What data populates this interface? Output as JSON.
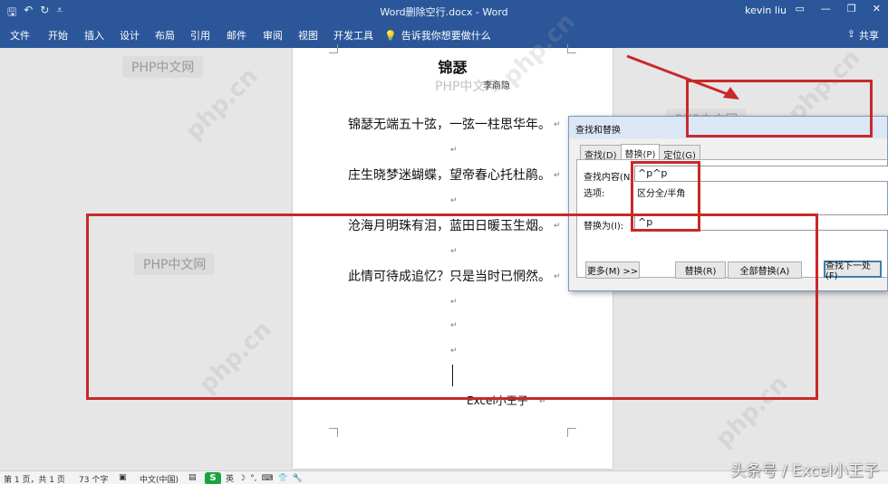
{
  "titlebar": {
    "qat_icons": [
      "save-icon",
      "undo-icon",
      "redo-icon",
      "customize-icon"
    ],
    "doc_title": "Word删除空行.docx - Word",
    "user": "kevin liu"
  },
  "ribbon": {
    "tabs": [
      "文件",
      "开始",
      "插入",
      "设计",
      "布局",
      "引用",
      "邮件",
      "审阅",
      "视图",
      "开发工具"
    ],
    "tell_me": "告诉我你想要做什么",
    "share": "共享"
  },
  "document": {
    "title": "锦瑟",
    "author": "李商隐",
    "lines": [
      "锦瑟无端五十弦，一弦一柱思华年。",
      "庄生晓梦迷蝴蝶，望帝春心托杜鹃。",
      "沧海月明珠有泪，蓝田日暖玉生烟。",
      "此情可待成追忆？只是当时已惘然。"
    ],
    "signature": "Excel小王子"
  },
  "dialog": {
    "title": "查找和替换",
    "tabs": [
      "查找(D)",
      "替换(P)",
      "定位(G)"
    ],
    "find_label": "查找内容(N):",
    "find_value": "^p^p",
    "options_label": "选项:",
    "options_value": "区分全/半角",
    "replace_label": "替换为(I):",
    "replace_value": "^p",
    "buttons": {
      "more": "更多(M) >>",
      "replace": "替换(R)",
      "replace_all": "全部替换(A)",
      "find_next": "查找下一处(F)"
    }
  },
  "watermarks": {
    "box_text": "PHP中文网",
    "diagonal_text": "php.cn"
  },
  "statusbar": {
    "page": "第 1 页，共 1 页",
    "words": "73 个字",
    "language": "中文(中国)",
    "ime_mode": "英"
  },
  "credit": "头条号 / Excel小王子",
  "colors": {
    "ribbon": "#2b579a",
    "annotation_red": "#c8292a",
    "ime_green": "#1aa340"
  }
}
